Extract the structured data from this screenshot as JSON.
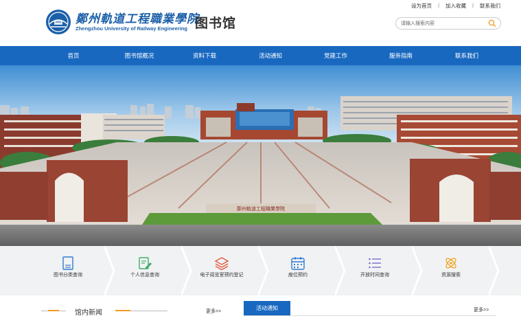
{
  "header": {
    "school_name_cn": "鄭州軌道工程職業學院",
    "school_name_en": "Zhengzhou University of Railway Engineering",
    "library_title": "图书馆",
    "top_links": [
      "设为首页",
      "加入收藏",
      "联系我们"
    ],
    "search_placeholder": "请输入搜索内容"
  },
  "nav": {
    "items": [
      "首页",
      "图书馆概况",
      "资料下载",
      "活动通知",
      "党建工作",
      "服务指南",
      "联系我们"
    ]
  },
  "banner": {
    "gate_sign_text": "鄭州軌道工程職業學院"
  },
  "quick_links": {
    "items": [
      {
        "label": "图书分类查询",
        "icon": "document-icon"
      },
      {
        "label": "个人信息查询",
        "icon": "edit-icon"
      },
      {
        "label": "电子阅览室预约登记",
        "icon": "layers-icon"
      },
      {
        "label": "座位预约",
        "icon": "calendar-icon"
      },
      {
        "label": "开放时间查询",
        "icon": "list-icon"
      },
      {
        "label": "资源搜索",
        "icon": "atom-icon"
      }
    ]
  },
  "news": {
    "left_title": "馆内新闻",
    "left_more": "更多>>",
    "right_tab": "活动通知",
    "right_more": "更多>>"
  },
  "colors": {
    "primary": "#1868c0",
    "accent_orange": "#f39a1f",
    "icon_blue": "#2e7ad1",
    "icon_green": "#3fae6b",
    "icon_red": "#e1573b",
    "icon_purple": "#7a6fd0",
    "icon_orange": "#f0a31e"
  }
}
